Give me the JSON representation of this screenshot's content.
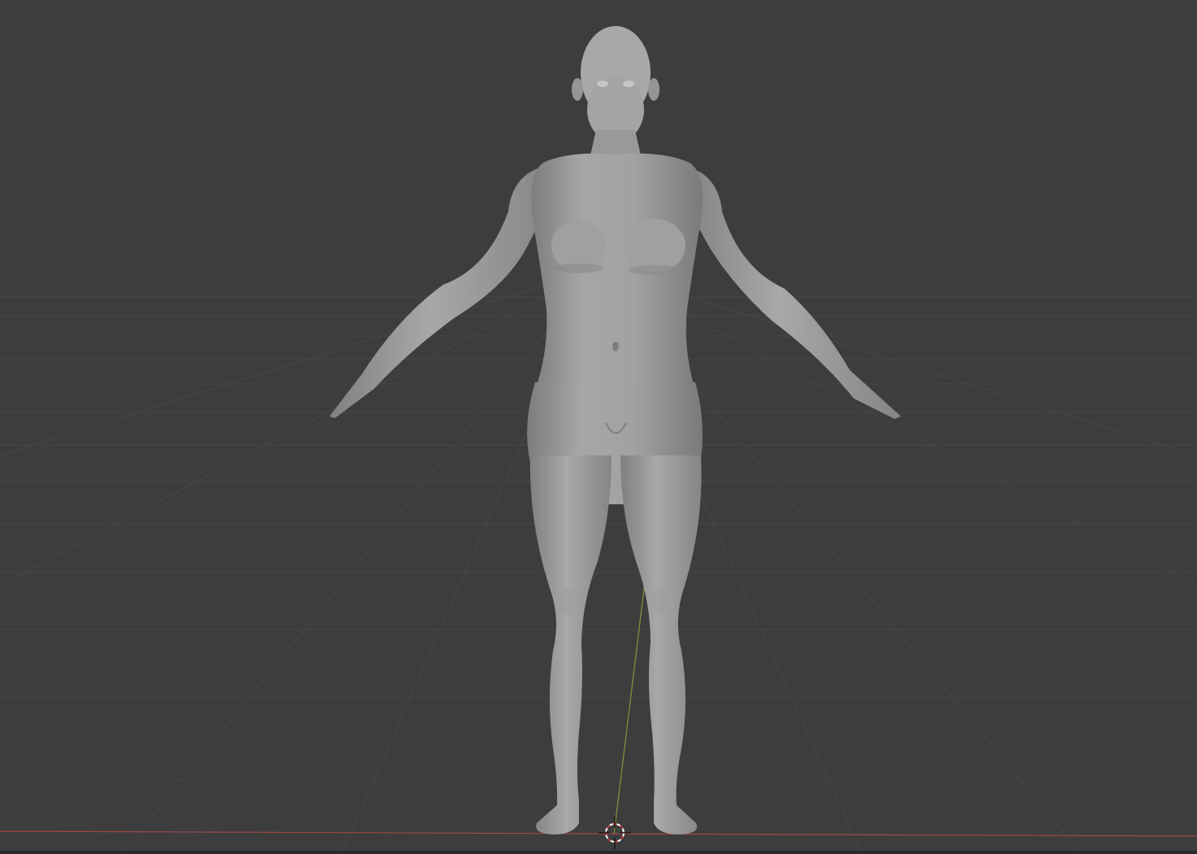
{
  "viewport": {
    "background_color": "#3d3d3d",
    "grid_color": "#484848",
    "floor_grid_color": "#4e4e4e",
    "x_axis_color": "#a04848",
    "y_axis_color": "#7a9a3a",
    "mesh_color": "#9c9c9c",
    "mesh_shadow_color": "#777777",
    "mesh_highlight_color": "#b4b4b4",
    "cursor_icon": "3d-cursor-icon",
    "cursor_colors": [
      "#ffffff",
      "#c83232"
    ]
  }
}
